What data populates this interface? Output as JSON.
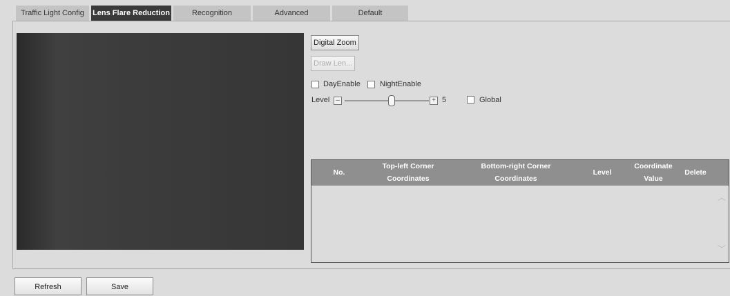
{
  "tabs": [
    {
      "label": "Traffic Light Config",
      "active": false
    },
    {
      "label": "Lens Flare Reduction",
      "active": true
    },
    {
      "label": "Recognition",
      "active": false
    },
    {
      "label": "Advanced",
      "active": false
    },
    {
      "label": "Default",
      "active": false
    }
  ],
  "controls": {
    "digital_zoom": "Digital Zoom",
    "draw_lens": "Draw Len...",
    "day_enable": "DayEnable",
    "night_enable": "NightEnable",
    "level_label": "Level",
    "level_minus": "–",
    "level_plus": "+",
    "level_value": "5",
    "level_fraction": 0.56,
    "global": "Global"
  },
  "table": {
    "headers": [
      {
        "line1": "No.",
        "line2": ""
      },
      {
        "line1": "Top-left Corner",
        "line2": "Coordinates"
      },
      {
        "line1": "Bottom-right Corner",
        "line2": "Coordinates"
      },
      {
        "line1": "Level",
        "line2": ""
      },
      {
        "line1": "Coordinate",
        "line2": "Value"
      },
      {
        "line1": "Delete",
        "line2": ""
      }
    ],
    "rows": [],
    "scroll_up": "︿",
    "scroll_down": "﹀"
  },
  "buttons": {
    "refresh": "Refresh",
    "save": "Save"
  },
  "colors": {
    "active_tab": "#3a3a3a",
    "table_header": "#8f8f8f",
    "background": "#dcdcdc"
  }
}
